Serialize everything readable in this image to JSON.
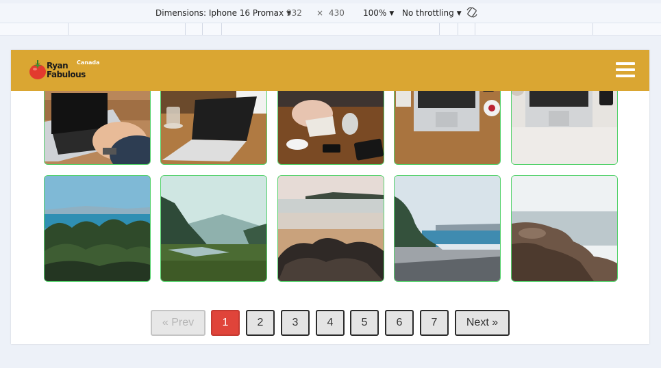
{
  "devtools": {
    "dimensions_label": "Dimensions: Iphone 16 Promax",
    "width": "932",
    "times": "×",
    "height": "430",
    "zoom": "100%",
    "throttling": "No throttling",
    "rotate_icon": "rotate-icon"
  },
  "header": {
    "brand_line1": "Ryan",
    "brand_line2": "Fabulous",
    "brand_sub": "Canada",
    "background": "#daa632",
    "logo_icon": "tomato-icon",
    "menu_icon": "hamburger-menu-icon"
  },
  "gallery": {
    "rows": [
      [
        "laptop-typing-photo",
        "laptop-coffee-photo",
        "desk-notebook-photo",
        "laptop-desk-topdown-photo",
        "laptop-phone-desk-photo"
      ],
      [
        "coast-trees-photo",
        "lake-forest-photo",
        "beach-rocks-photo",
        "pebble-beach-photo",
        "rocky-shore-photo"
      ]
    ],
    "border_color": "#53d26b"
  },
  "pagination": {
    "prev": "« Prev",
    "pages": [
      "1",
      "2",
      "3",
      "4",
      "5",
      "6",
      "7"
    ],
    "current": "1",
    "next": "Next »",
    "active_color": "#e0443a"
  }
}
